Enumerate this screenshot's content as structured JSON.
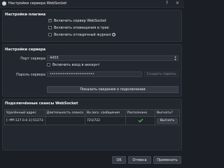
{
  "window": {
    "title": "Настройки сервера WebSocket",
    "help_symbol": "?",
    "close_symbol": "×"
  },
  "plugin_settings": {
    "title": "Настройки плагина",
    "enable_server": {
      "label": "Включить сервер WebSocket",
      "checked": true
    },
    "tray_alerts": {
      "label": "Включить оповещения в трее",
      "checked": false
    },
    "debug_log": {
      "label": "Включить отладочный журнал",
      "checked": false
    }
  },
  "server_settings": {
    "title": "Настройки сервера",
    "port_label": "Порт сервера",
    "port_value": "4455",
    "auth": {
      "label": "Включить вход в аккаунт",
      "checked": false
    },
    "password_label": "Пароль сервера",
    "password_mask": "••••••••••••••••••••••••",
    "generate_password_button": "Создать пароль",
    "show_connect_info_button": "Показать сведения о подключении"
  },
  "sessions": {
    "title": "Подключённые сеансы WebSocket",
    "columns": [
      "Удалённый адрес",
      "Длительность сеанса",
      "Вх./исх. сообщения",
      "Распознано",
      "Выгнать?"
    ],
    "rows": [
      {
        "address": "[::ffff:127.0.0.1]:51273",
        "duration": "",
        "messages": "721/722",
        "identified_icon": "check-icon",
        "kick_label": "Выгнать"
      }
    ]
  },
  "footer": {
    "ok": "OK",
    "cancel": "Отмена",
    "apply": "Применить"
  },
  "colors": {
    "background": "#1b1e25",
    "group_background": "#23272f",
    "identified_green": "#4caf50"
  }
}
